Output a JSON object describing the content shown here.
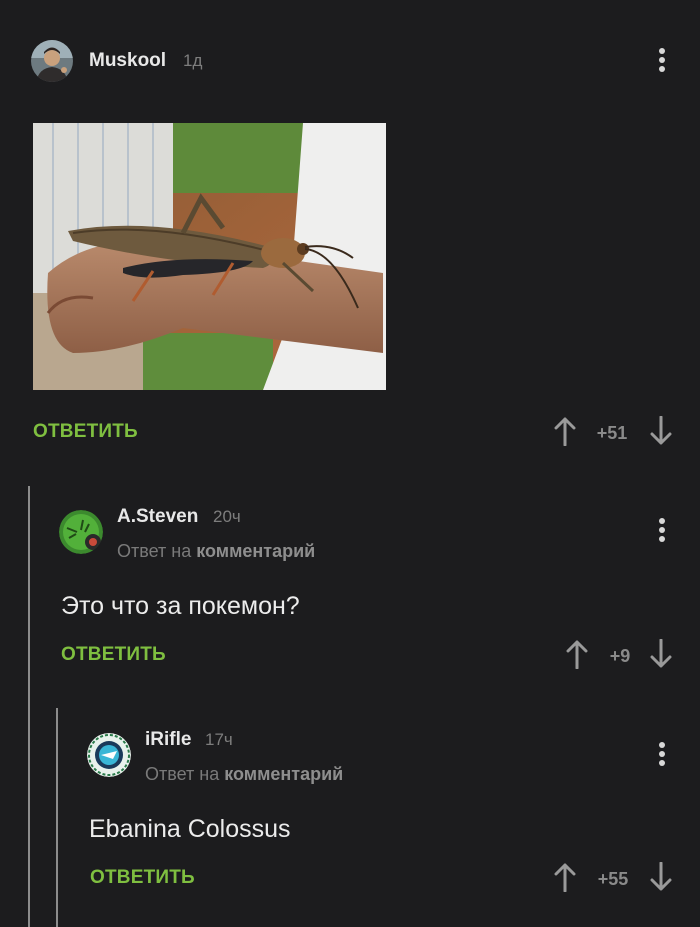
{
  "post": {
    "author": "Muskool",
    "time": "1д",
    "reply_label": "ОТВЕТИТЬ",
    "score": "+51"
  },
  "comments": [
    {
      "author": "A.Steven",
      "time": "20ч",
      "reply_prefix": "Ответ на",
      "reply_target": "комментарий",
      "text": "Это что за покемон?",
      "reply_label": "ОТВЕТИТЬ",
      "score": "+9"
    },
    {
      "author": "iRifle",
      "time": "17ч",
      "reply_prefix": "Ответ на",
      "reply_target": "комментарий",
      "text": "Ebanina Colossus",
      "reply_label": "ОТВЕТИТЬ",
      "score": "+55"
    }
  ],
  "icons": {
    "menu": "more-vertical-icon",
    "upvote": "arrow-up-icon",
    "downvote": "arrow-down-icon"
  },
  "colors": {
    "background": "#1c1c1e",
    "reply_green": "#7fbf40",
    "muted": "#7d7d7d"
  }
}
